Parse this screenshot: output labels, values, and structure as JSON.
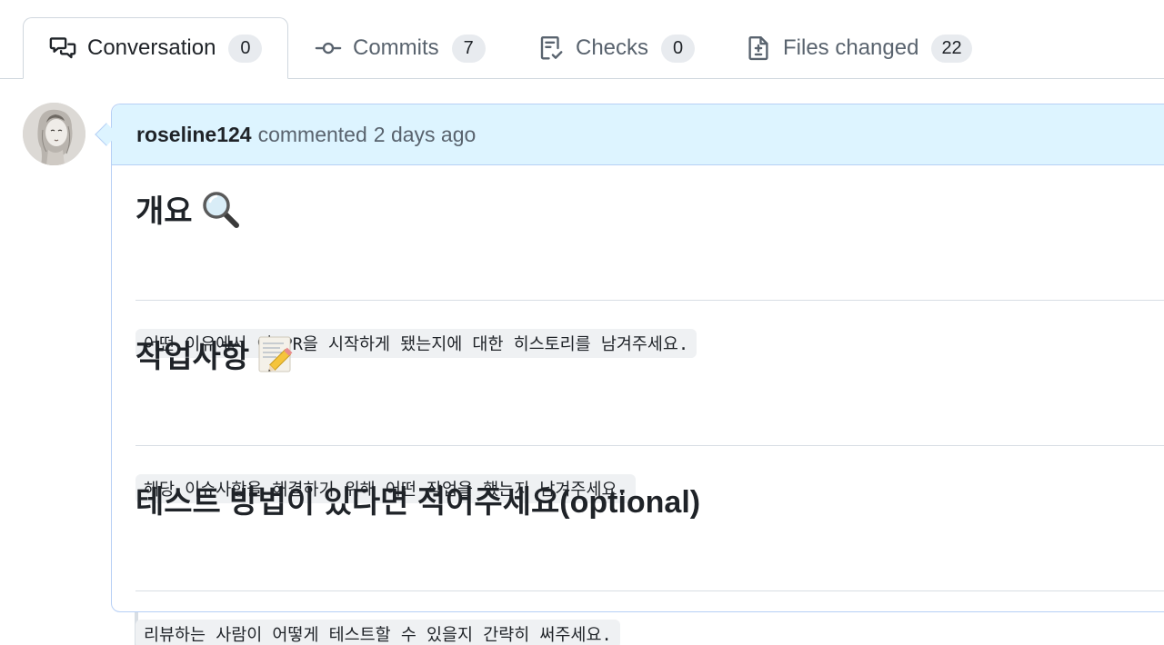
{
  "tabs": [
    {
      "label": "Conversation",
      "count": "0",
      "icon": "comment-discussion-icon",
      "selected": true
    },
    {
      "label": "Commits",
      "count": "7",
      "icon": "git-commit-icon",
      "selected": false
    },
    {
      "label": "Checks",
      "count": "0",
      "icon": "checklist-icon",
      "selected": false
    },
    {
      "label": "Files changed",
      "count": "22",
      "icon": "file-diff-icon",
      "selected": false
    }
  ],
  "comment": {
    "author": "roseline124",
    "action": "commented",
    "time": "2 days ago",
    "sections": [
      {
        "heading": "개요",
        "emoji": "magnifying-glass-icon",
        "text": "어떤 이유에서 이 PR을 시작하게 됐는지에 대한 히스토리를 남겨주세요."
      },
      {
        "heading": "작업사항",
        "emoji": "memo-icon",
        "text": "해당 이슈사항을 해결하기 위해 어떤 작업을 했는지 남겨주세요."
      },
      {
        "heading": "테스트 방법이 있다면 적어주세요(optional)",
        "emoji": "",
        "text": "리뷰하는 사람이 어떻게 테스트할 수 있을지 간략히 써주세요."
      }
    ]
  },
  "colors": {
    "header_bg": "#ddf4ff",
    "border_accent": "#b6cff5",
    "counter_bg": "#e8ebef",
    "code_bg": "#eff1f3"
  }
}
